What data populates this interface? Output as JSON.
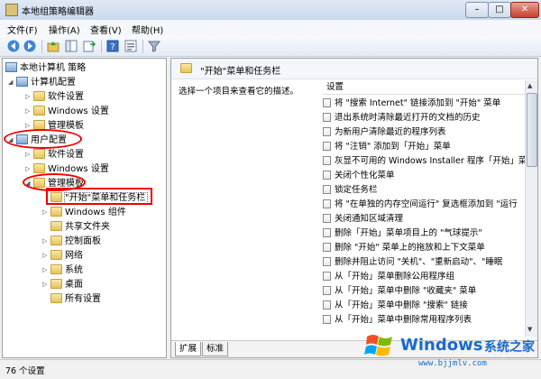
{
  "window": {
    "title": "本地组策略编辑器",
    "minimize_glyph": "–",
    "maximize_glyph": "□",
    "close_glyph": "✕"
  },
  "menu": [
    "文件(F)",
    "操作(A)",
    "查看(V)",
    "帮助(H)"
  ],
  "toolbar_icons": [
    "back-arrow-icon",
    "forward-arrow-icon",
    "up-folder-icon",
    "show-tree-icon",
    "export-list-icon",
    "help-icon",
    "properties-icon",
    "filter-icon"
  ],
  "tree": {
    "root": "本地计算机 策略",
    "computer_config": "计算机配置",
    "cc_software": "软件设置",
    "cc_windows": "Windows 设置",
    "cc_admin": "管理模板",
    "user_config": "用户配置",
    "uc_software": "软件设置",
    "uc_windows": "Windows 设置",
    "uc_admin": "管理模板",
    "start_menu": "\"开始\"菜单和任务栏",
    "win_components": "Windows 组件",
    "shared_folders": "共享文件夹",
    "control_panel": "控制面板",
    "network": "网络",
    "system": "系统",
    "desktop": "桌面",
    "all_settings": "所有设置"
  },
  "right": {
    "header": "\"开始\"菜单和任务栏",
    "description": "选择一个项目来查看它的描述。",
    "column_header": "设置",
    "rows": [
      "将 \"搜索 Internet\" 链接添加到 \"开始\" 菜单",
      "退出系统时清除最近打开的文档的历史",
      "为新用户清除最近的程序列表",
      "将 \"注销\" 添加到「开始」菜单",
      "灰显不可用的 Windows Installer 程序「开始」菜",
      "关闭个性化菜单",
      "锁定任务栏",
      "将 \"在单独的内存空间运行\" 复选框添加到 \"运行",
      "关闭通知区域清理",
      "删除「开始」菜单项目上的 \"气球提示\"",
      "删除 \"开始\" 菜单上的拖放和上下文菜单",
      "删除并阻止访问 \"关机\"、\"重新启动\"、\"睡眠",
      "从「开始」菜单删除公用程序组",
      "从「开始」菜单中删除 \"收藏夹\" 菜单",
      "从「开始」菜单中删除 \"搜索\" 链接",
      "从「开始」菜单中删除常用程序列表"
    ],
    "tabs": [
      "扩展",
      "标准"
    ]
  },
  "status": "76 个设置",
  "watermark": {
    "brand": "Windows",
    "suffix": "系统之家",
    "url": "www.bjjmlv.com"
  }
}
